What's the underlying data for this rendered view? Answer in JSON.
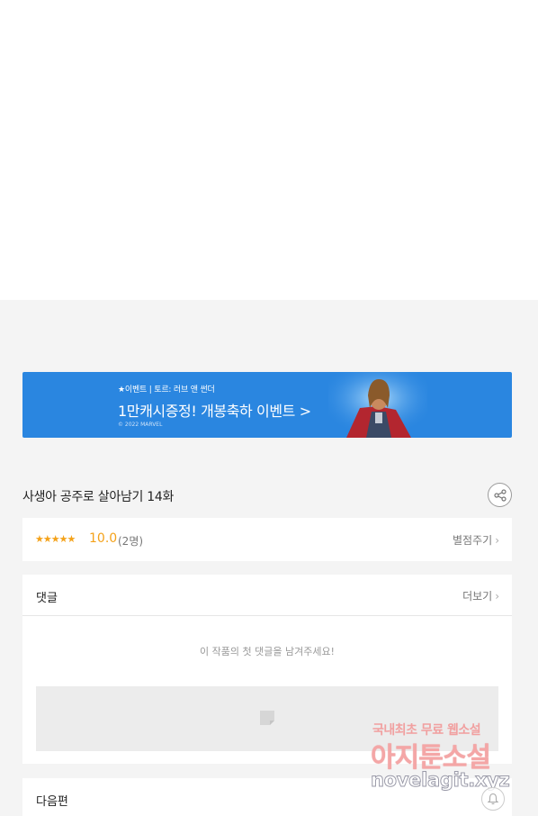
{
  "banner": {
    "small_text": "★이벤트 | 토르: 러브 앤 썬더",
    "main_text": "1만캐시증정! 개봉축하 이벤트 >",
    "copyright": "© 2022 MARVEL",
    "background_color": "#2a86e0"
  },
  "episode": {
    "title": "사생아 공주로 살아남기 14화",
    "share_icon": "share-icon"
  },
  "rating": {
    "stars": "★★★★★",
    "score": "10.0",
    "count": "(2명)",
    "rate_link": "별점주기",
    "star_color": "#f4a21a"
  },
  "comments": {
    "label": "댓글",
    "more_link": "더보기",
    "empty_message": "이 작품의 첫 댓글을 남겨주세요!"
  },
  "next": {
    "label": "다음편"
  },
  "watermark": {
    "line1": "국내최초 무료 웹소설",
    "line2": "아지툰소설",
    "line3": "novelagit.xyz"
  }
}
